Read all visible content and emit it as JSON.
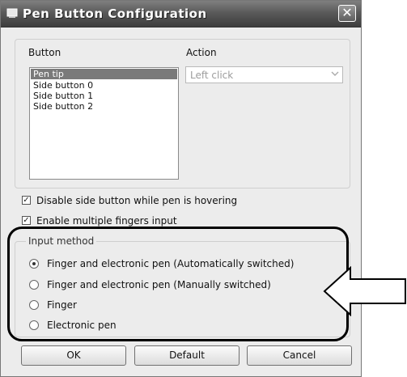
{
  "window": {
    "title": "Pen Button Configuration",
    "close_label": "✕"
  },
  "panel": {
    "button_header": "Button",
    "action_header": "Action",
    "buttons": [
      "Pen tip",
      "Side button 0",
      "Side button 1",
      "Side button 2"
    ],
    "selected_index": 0,
    "action_value": "Left click"
  },
  "checkboxes": [
    {
      "label": "Disable side button while pen is hovering",
      "checked": true
    },
    {
      "label": "Enable multiple fingers input",
      "checked": true
    }
  ],
  "input_method": {
    "title": "Input method",
    "options": [
      {
        "label": "Finger and electronic pen (Automatically switched)",
        "selected": true
      },
      {
        "label": "Finger and electronic pen (Manually switched)",
        "selected": false
      },
      {
        "label": "Finger",
        "selected": false
      },
      {
        "label": "Electronic pen",
        "selected": false
      }
    ]
  },
  "buttons": {
    "ok": "OK",
    "default": "Default",
    "cancel": "Cancel"
  },
  "icons": {
    "window_icon": "pen-tablet-icon",
    "callout": "arrow-left-icon"
  }
}
